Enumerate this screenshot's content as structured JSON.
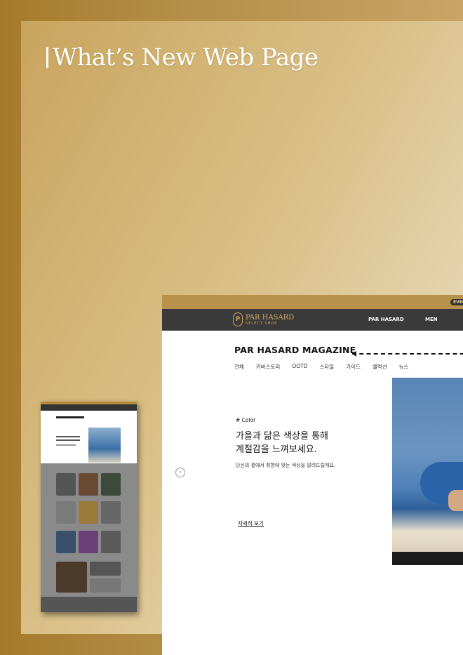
{
  "heading": "What’s New Web Page",
  "site": {
    "event_badge": "EVEN",
    "logo_name": "PAR HASARD",
    "logo_sub": "SELECT SHOP",
    "nav": [
      "PAR HASARD",
      "MEN"
    ],
    "magazine_title": "PAR HASARD MAGAZINE",
    "tabs": [
      "전체",
      "커버스토리",
      "OOTD",
      "스타일",
      "가이드",
      "셀럭션",
      "뉴스"
    ],
    "tag": "# Color",
    "headline_1": "가을과 닮은 색상을 통해",
    "headline_2": "계절감을 느껴보세요.",
    "description": "당신의 곁에서 취향에 맞는 색상을 알려드릴게요.",
    "more_link": "자세히 보기",
    "prev_icon": "chevron-left-icon"
  },
  "colors": {
    "gold": "#b8924b",
    "nav_dark": "#3a3a3a",
    "logo_gold": "#d4ae66"
  }
}
